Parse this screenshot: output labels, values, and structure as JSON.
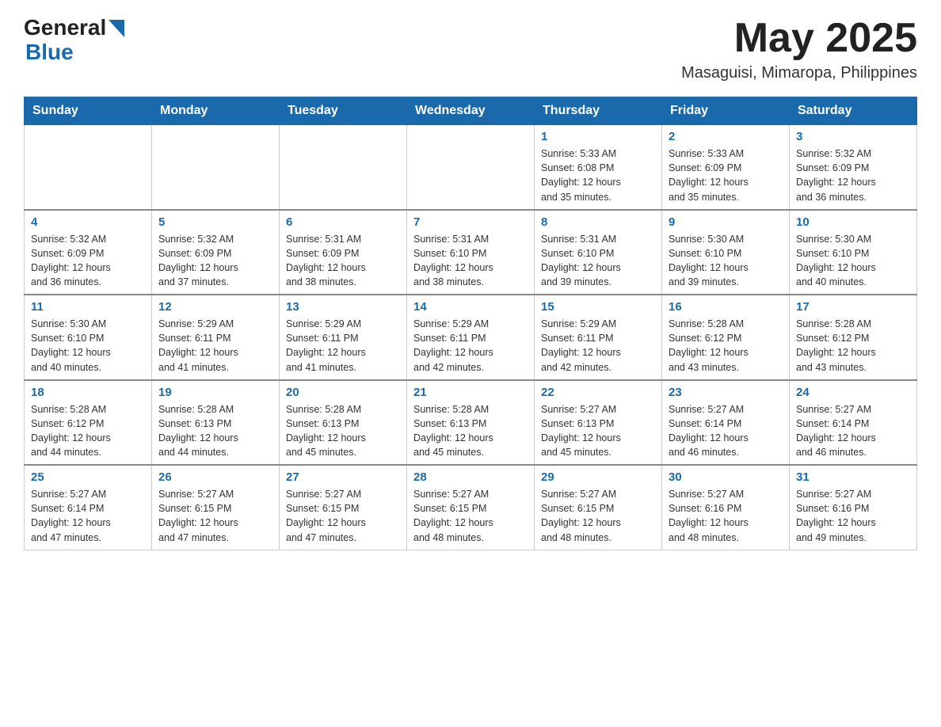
{
  "header": {
    "logo_general": "General",
    "logo_blue": "Blue",
    "month_title": "May 2025",
    "location": "Masaguisi, Mimaropa, Philippines"
  },
  "weekdays": [
    "Sunday",
    "Monday",
    "Tuesday",
    "Wednesday",
    "Thursday",
    "Friday",
    "Saturday"
  ],
  "weeks": [
    [
      {
        "day": "",
        "info": ""
      },
      {
        "day": "",
        "info": ""
      },
      {
        "day": "",
        "info": ""
      },
      {
        "day": "",
        "info": ""
      },
      {
        "day": "1",
        "info": "Sunrise: 5:33 AM\nSunset: 6:08 PM\nDaylight: 12 hours\nand 35 minutes."
      },
      {
        "day": "2",
        "info": "Sunrise: 5:33 AM\nSunset: 6:09 PM\nDaylight: 12 hours\nand 35 minutes."
      },
      {
        "day": "3",
        "info": "Sunrise: 5:32 AM\nSunset: 6:09 PM\nDaylight: 12 hours\nand 36 minutes."
      }
    ],
    [
      {
        "day": "4",
        "info": "Sunrise: 5:32 AM\nSunset: 6:09 PM\nDaylight: 12 hours\nand 36 minutes."
      },
      {
        "day": "5",
        "info": "Sunrise: 5:32 AM\nSunset: 6:09 PM\nDaylight: 12 hours\nand 37 minutes."
      },
      {
        "day": "6",
        "info": "Sunrise: 5:31 AM\nSunset: 6:09 PM\nDaylight: 12 hours\nand 38 minutes."
      },
      {
        "day": "7",
        "info": "Sunrise: 5:31 AM\nSunset: 6:10 PM\nDaylight: 12 hours\nand 38 minutes."
      },
      {
        "day": "8",
        "info": "Sunrise: 5:31 AM\nSunset: 6:10 PM\nDaylight: 12 hours\nand 39 minutes."
      },
      {
        "day": "9",
        "info": "Sunrise: 5:30 AM\nSunset: 6:10 PM\nDaylight: 12 hours\nand 39 minutes."
      },
      {
        "day": "10",
        "info": "Sunrise: 5:30 AM\nSunset: 6:10 PM\nDaylight: 12 hours\nand 40 minutes."
      }
    ],
    [
      {
        "day": "11",
        "info": "Sunrise: 5:30 AM\nSunset: 6:10 PM\nDaylight: 12 hours\nand 40 minutes."
      },
      {
        "day": "12",
        "info": "Sunrise: 5:29 AM\nSunset: 6:11 PM\nDaylight: 12 hours\nand 41 minutes."
      },
      {
        "day": "13",
        "info": "Sunrise: 5:29 AM\nSunset: 6:11 PM\nDaylight: 12 hours\nand 41 minutes."
      },
      {
        "day": "14",
        "info": "Sunrise: 5:29 AM\nSunset: 6:11 PM\nDaylight: 12 hours\nand 42 minutes."
      },
      {
        "day": "15",
        "info": "Sunrise: 5:29 AM\nSunset: 6:11 PM\nDaylight: 12 hours\nand 42 minutes."
      },
      {
        "day": "16",
        "info": "Sunrise: 5:28 AM\nSunset: 6:12 PM\nDaylight: 12 hours\nand 43 minutes."
      },
      {
        "day": "17",
        "info": "Sunrise: 5:28 AM\nSunset: 6:12 PM\nDaylight: 12 hours\nand 43 minutes."
      }
    ],
    [
      {
        "day": "18",
        "info": "Sunrise: 5:28 AM\nSunset: 6:12 PM\nDaylight: 12 hours\nand 44 minutes."
      },
      {
        "day": "19",
        "info": "Sunrise: 5:28 AM\nSunset: 6:13 PM\nDaylight: 12 hours\nand 44 minutes."
      },
      {
        "day": "20",
        "info": "Sunrise: 5:28 AM\nSunset: 6:13 PM\nDaylight: 12 hours\nand 45 minutes."
      },
      {
        "day": "21",
        "info": "Sunrise: 5:28 AM\nSunset: 6:13 PM\nDaylight: 12 hours\nand 45 minutes."
      },
      {
        "day": "22",
        "info": "Sunrise: 5:27 AM\nSunset: 6:13 PM\nDaylight: 12 hours\nand 45 minutes."
      },
      {
        "day": "23",
        "info": "Sunrise: 5:27 AM\nSunset: 6:14 PM\nDaylight: 12 hours\nand 46 minutes."
      },
      {
        "day": "24",
        "info": "Sunrise: 5:27 AM\nSunset: 6:14 PM\nDaylight: 12 hours\nand 46 minutes."
      }
    ],
    [
      {
        "day": "25",
        "info": "Sunrise: 5:27 AM\nSunset: 6:14 PM\nDaylight: 12 hours\nand 47 minutes."
      },
      {
        "day": "26",
        "info": "Sunrise: 5:27 AM\nSunset: 6:15 PM\nDaylight: 12 hours\nand 47 minutes."
      },
      {
        "day": "27",
        "info": "Sunrise: 5:27 AM\nSunset: 6:15 PM\nDaylight: 12 hours\nand 47 minutes."
      },
      {
        "day": "28",
        "info": "Sunrise: 5:27 AM\nSunset: 6:15 PM\nDaylight: 12 hours\nand 48 minutes."
      },
      {
        "day": "29",
        "info": "Sunrise: 5:27 AM\nSunset: 6:15 PM\nDaylight: 12 hours\nand 48 minutes."
      },
      {
        "day": "30",
        "info": "Sunrise: 5:27 AM\nSunset: 6:16 PM\nDaylight: 12 hours\nand 48 minutes."
      },
      {
        "day": "31",
        "info": "Sunrise: 5:27 AM\nSunset: 6:16 PM\nDaylight: 12 hours\nand 49 minutes."
      }
    ]
  ]
}
